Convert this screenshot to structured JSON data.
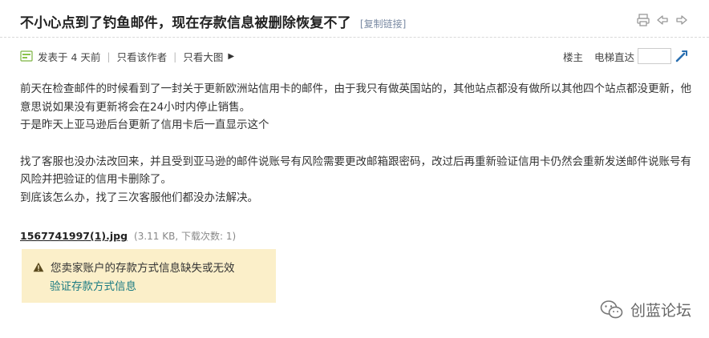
{
  "post": {
    "title": "不小心点到了钓鱼邮件，现在存款信息被删除恢复不了",
    "copy_link": "[复制链接]"
  },
  "meta": {
    "posted": "发表于 4 天前",
    "only_author": "只看该作者",
    "only_images": "只看大图",
    "floor": "楼主",
    "elevator": "电梯直达",
    "jump_value": ""
  },
  "content": {
    "p1": "前天在检查邮件的时候看到了一封关于更新欧洲站信用卡的邮件，由于我只有做英国站的，其他站点都没有做所以其他四个站点都没更新，他意思说如果没有更新将会在24小时内停止销售。",
    "p2": "于是昨天上亚马逊后台更新了信用卡后一直显示这个",
    "p3": "找了客服也没办法改回来，并且受到亚马逊的邮件说账号有风险需要更改邮箱跟密码，改过后再重新验证信用卡仍然会重新发送邮件说账号有风险并把验证的信用卡删除了。",
    "p4": "到底该怎么办，找了三次客服他们都没办法解决。"
  },
  "attachment": {
    "name": "1567741997(1).jpg",
    "meta": "(3.11 KB, 下载次数: 1)"
  },
  "warning": {
    "message": "您卖家账户的存款方式信息缺失或无效",
    "link": "验证存款方式信息"
  },
  "watermark": {
    "text": "创蓝论坛"
  },
  "colors": {
    "warning_bg": "#fbefc9",
    "link": "#1b7b82",
    "copy_link": "#7a8aa3"
  }
}
